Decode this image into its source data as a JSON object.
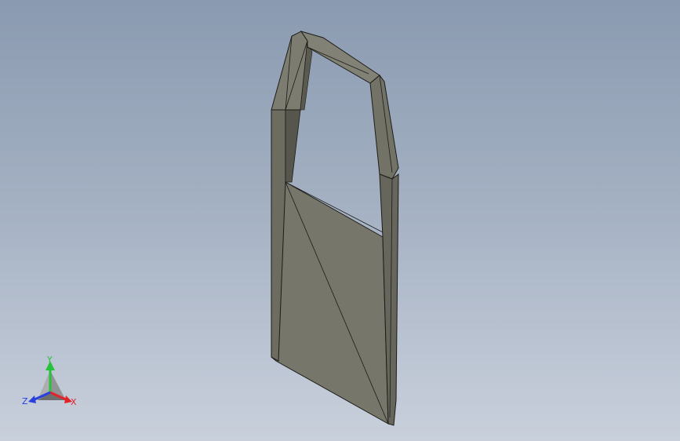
{
  "viewport": {
    "background_top": "#8a9ab0",
    "background_bottom": "#c9d0dc"
  },
  "model": {
    "part_icon": "cad-part-frame",
    "face_color": "#76766a",
    "face_dark": "#5d5d53",
    "face_light": "#8c8c80",
    "edge_color": "#1c1c18"
  },
  "triad": {
    "x_label": "X",
    "y_label": "Y",
    "z_label": "Z",
    "x_color": "#e0242a",
    "y_color": "#26c23c",
    "z_color": "#2a3fe0"
  }
}
